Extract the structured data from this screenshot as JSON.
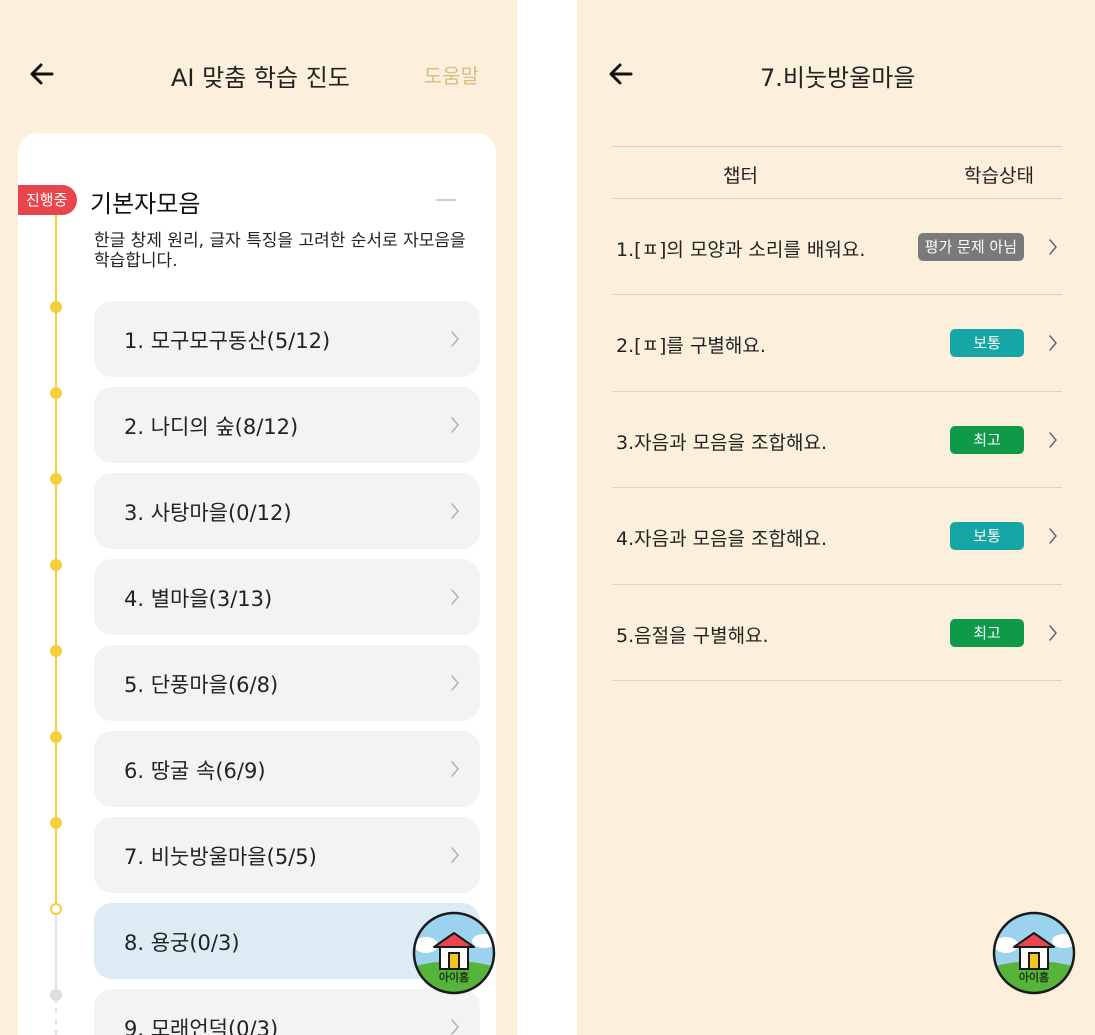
{
  "colors": {
    "background": "#fcf0dc",
    "accent_yellow": "#f3cf3a",
    "progress_red": "#e9464b",
    "active_item": "#dcebf4",
    "status_gray": "#7a7a7a",
    "status_teal": "#17a6a6",
    "status_green": "#0f9a4a",
    "help_gold": "#d9bd84"
  },
  "left": {
    "back_icon": "arrow-left-icon",
    "title": "AI 맞춤 학습 진도",
    "help_label": "도움말",
    "section": {
      "badge": "진행중",
      "title": "기본자모음",
      "description": "한글 창제 원리, 글자 특징을 고려한 순서로 자모음을 학습합니다.",
      "collapse_icon": "minus-icon"
    },
    "lessons": [
      {
        "label": "1. 모구모구동산(5/12)",
        "state": "done"
      },
      {
        "label": "2. 나디의 숲(8/12)",
        "state": "done"
      },
      {
        "label": "3. 사탕마을(0/12)",
        "state": "done"
      },
      {
        "label": "4. 별마을(3/13)",
        "state": "done"
      },
      {
        "label": "5. 단풍마을(6/8)",
        "state": "done"
      },
      {
        "label": "6. 땅굴 속(6/9)",
        "state": "done"
      },
      {
        "label": "7. 비눗방울마을(5/5)",
        "state": "done"
      },
      {
        "label": "8. 용궁(0/3)",
        "state": "current"
      },
      {
        "label": "9. 모래언덕(0/3)",
        "state": "todo"
      }
    ],
    "home_button": {
      "label": "아이홈",
      "icon": "house-icon"
    }
  },
  "right": {
    "back_icon": "arrow-left-icon",
    "title": "7.비눗방울마을",
    "table": {
      "headers": {
        "chapter": "챕터",
        "status": "학습상태"
      },
      "rows": [
        {
          "chapter": "1.[ㅍ]의 모양과 소리를 배워요.",
          "status": "평가 문제 아님",
          "status_color": "#7a7a7a"
        },
        {
          "chapter": "2.[ㅍ]를 구별해요.",
          "status": "보통",
          "status_color": "#17a6a6"
        },
        {
          "chapter": "3.자음과 모음을 조합해요.",
          "status": "최고",
          "status_color": "#0f9a4a"
        },
        {
          "chapter": "4.자음과 모음을 조합해요.",
          "status": "보통",
          "status_color": "#17a6a6"
        },
        {
          "chapter": "5.음절을 구별해요.",
          "status": "최고",
          "status_color": "#0f9a4a"
        }
      ]
    },
    "home_button": {
      "label": "아이홈",
      "icon": "house-icon"
    }
  }
}
